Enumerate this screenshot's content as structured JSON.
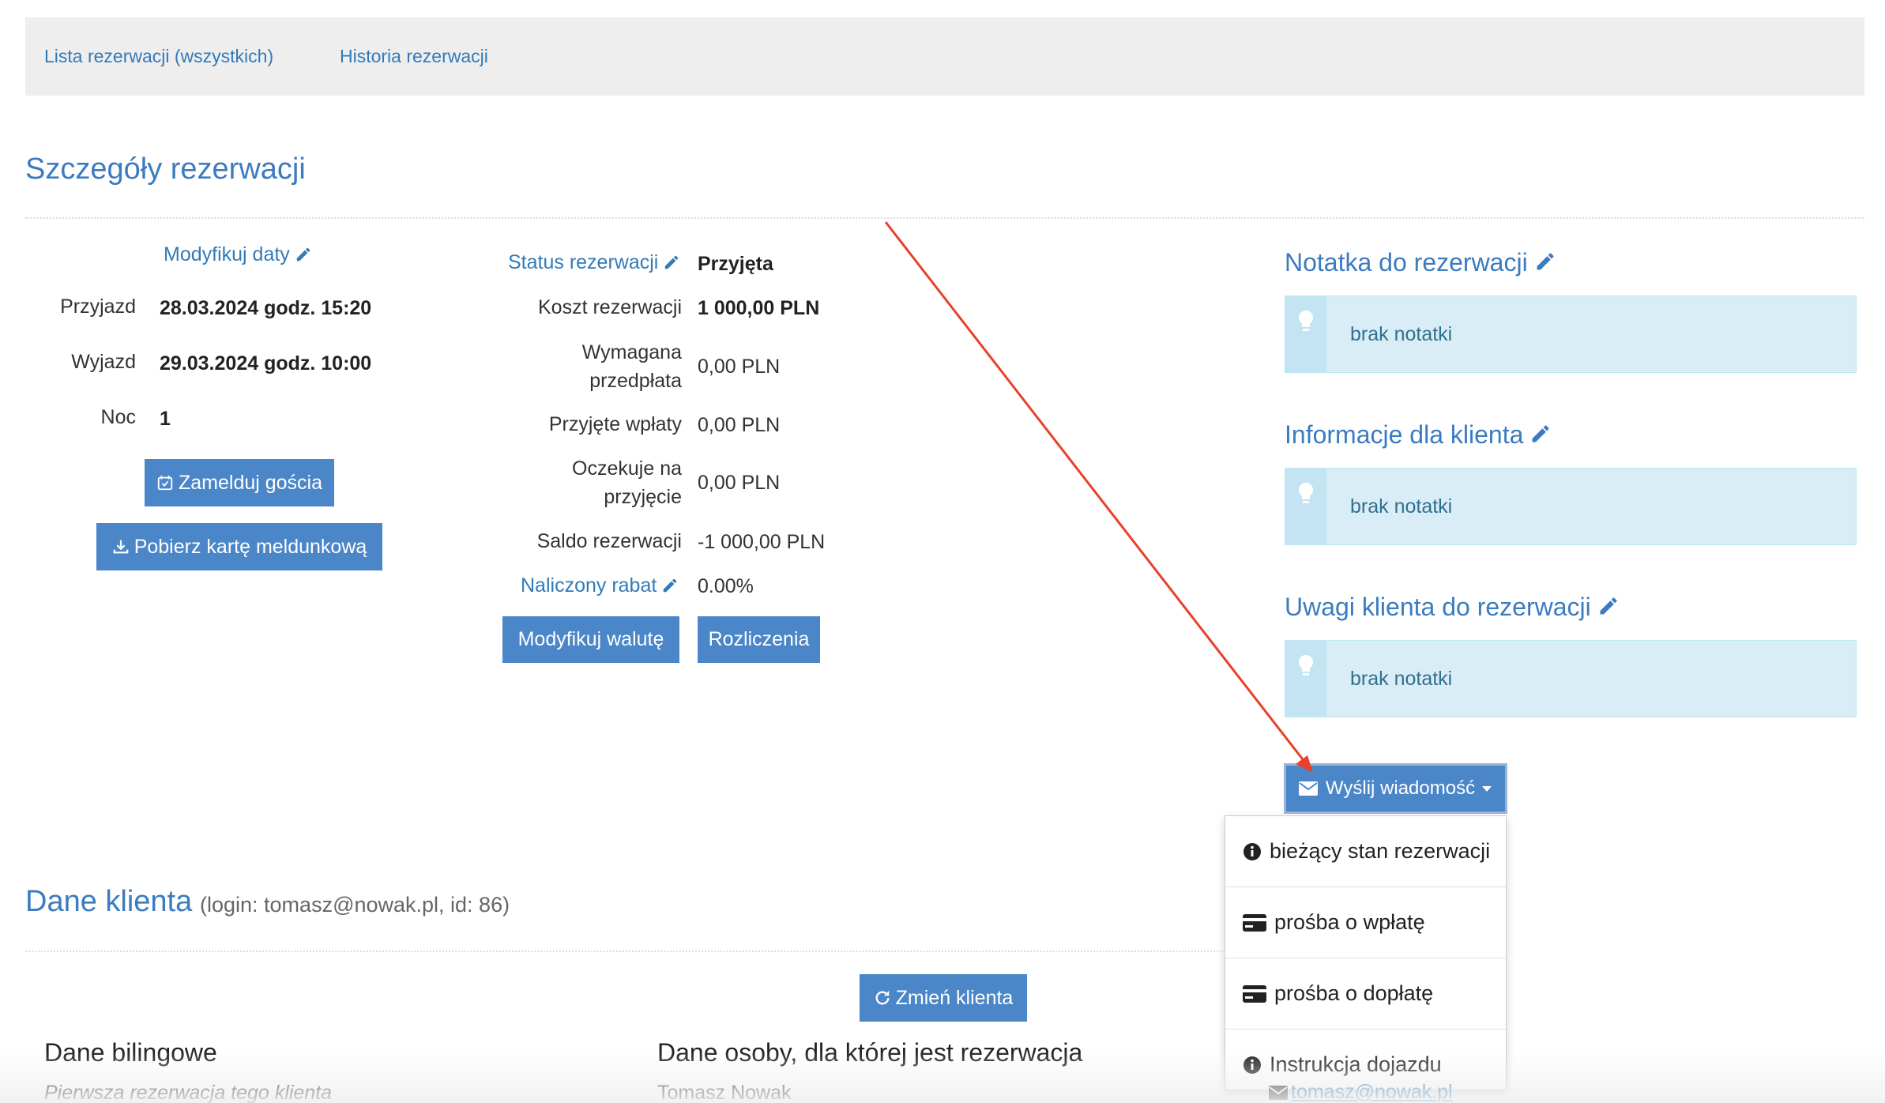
{
  "nav": {
    "link1": "Lista rezerwacji (wszystkich)",
    "link2": "Historia rezerwacji"
  },
  "details": {
    "title": "Szczegóły rezerwacji",
    "modify_dates": "Modyfikuj daty",
    "arrival_label": "Przyjazd",
    "arrival_value": "28.03.2024 godz. 15:20",
    "departure_label": "Wyjazd",
    "departure_value": "29.03.2024 godz. 10:00",
    "nights_label": "Noc",
    "nights_value": "1",
    "checkin_button": "Zamelduj gościa",
    "download_button": "Pobierz kartę meldunkową"
  },
  "finance": {
    "status_label": "Status rezerwacji",
    "status_value": "Przyjęta",
    "cost_label": "Koszt rezerwacji",
    "cost_value": "1 000,00 PLN",
    "prepay_label": "Wymagana przedpłata",
    "prepay_value": "0,00 PLN",
    "received_label": "Przyjęte wpłaty",
    "received_value": "0,00 PLN",
    "pending_label": "Oczekuje na przyjęcie",
    "pending_value": "0,00 PLN",
    "balance_label": "Saldo rezerwacji",
    "balance_value": "-1 000,00 PLN",
    "discount_label": "Naliczony rabat",
    "discount_value": "0.00%",
    "currency_button": "Modyfikuj walutę",
    "settlements_button": "Rozliczenia"
  },
  "notes": {
    "note_title": "Notatka do rezerwacji",
    "note_text": "brak notatki",
    "client_info_title": "Informacje dla klienta",
    "client_info_text": "brak notatki",
    "client_remarks_title": "Uwagi klienta do rezerwacji",
    "client_remarks_text": "brak notatki"
  },
  "send_message": {
    "button": "Wyślij wiadomość",
    "items": [
      "bieżący stan rezerwacji",
      "prośba o wpłatę",
      "prośba o dopłatę",
      "Instrukcja dojazdu"
    ]
  },
  "client": {
    "title": "Dane klienta",
    "login_info": "(login: tomasz@nowak.pl, id: 86)",
    "change_button": "Zmień klienta",
    "billing_heading": "Dane bilingowe",
    "first_reservation": "Pierwsza rezerwacja tego klienta",
    "person_heading": "Dane osoby, dla której jest rezerwacja",
    "person_name": "Tomasz Nowak",
    "email": "tomasz@nowak.pl"
  },
  "colors": {
    "primary": "#4a86c8",
    "link": "#337ab7",
    "heading": "#3b7bc0",
    "note_bg": "#d9edf7",
    "arrow": "#e8402a"
  },
  "icons": [
    "pencil-icon",
    "calendar-check-icon",
    "download-icon",
    "lightbulb-icon",
    "envelope-icon",
    "caret-down-icon",
    "info-circle-icon",
    "credit-card-icon",
    "refresh-icon"
  ]
}
